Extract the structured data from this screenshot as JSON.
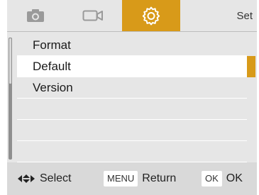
{
  "tabs": [
    {
      "icon": "camera-icon"
    },
    {
      "icon": "video-icon"
    },
    {
      "icon": "gear-icon",
      "active": true
    },
    {
      "label": "Set"
    }
  ],
  "menu": {
    "items": [
      {
        "label": "Format"
      },
      {
        "label": "Default",
        "selected": true
      },
      {
        "label": "Version"
      },
      {
        "label": ""
      },
      {
        "label": ""
      },
      {
        "label": ""
      }
    ]
  },
  "footer": {
    "select_label": "Select",
    "return_key": "MENU",
    "return_label": "Return",
    "ok_key": "OK",
    "ok_label": "OK"
  },
  "colors": {
    "accent": "#d89a19",
    "background": "#e6e6e6",
    "selected_row": "#ffffff",
    "footer": "#d9d9d9"
  }
}
